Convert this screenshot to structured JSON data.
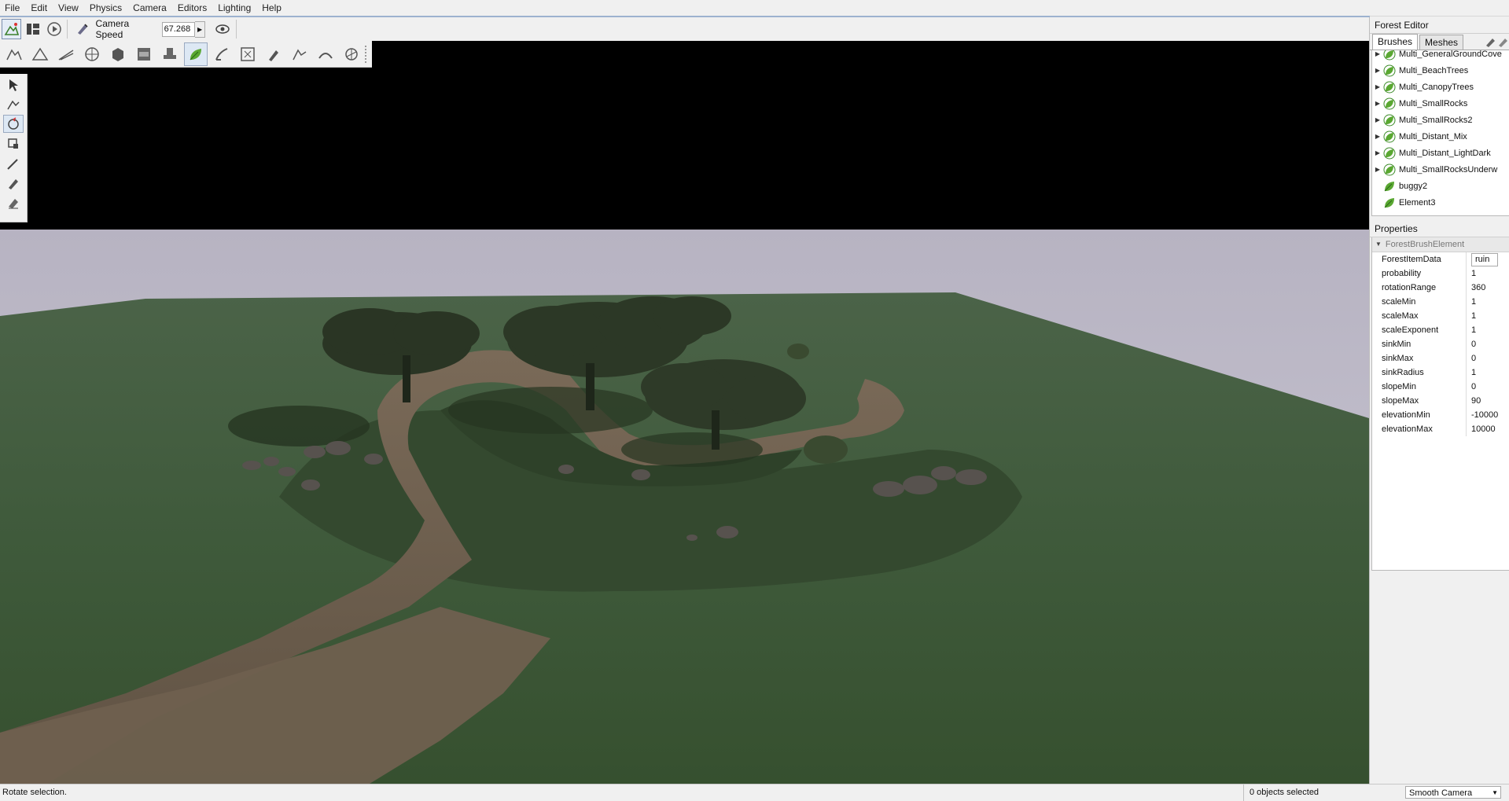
{
  "menu": {
    "items": [
      "File",
      "Edit",
      "View",
      "Physics",
      "Camera",
      "Editors",
      "Lighting",
      "Help"
    ]
  },
  "toolbar": {
    "camera_speed_label": "Camera Speed",
    "camera_speed_value": "67.268"
  },
  "forest_editor": {
    "title": "Forest Editor",
    "tabs": [
      "Brushes",
      "Meshes"
    ],
    "active_tab": "Brushes",
    "tree": [
      {
        "label": "Multi_GeneralGroundCove",
        "expandable": true
      },
      {
        "label": "Multi_BeachTrees",
        "expandable": true
      },
      {
        "label": "Multi_CanopyTrees",
        "expandable": true
      },
      {
        "label": "Multi_SmallRocks",
        "expandable": true
      },
      {
        "label": "Multi_SmallRocks2",
        "expandable": true
      },
      {
        "label": "Multi_Distant_Mix",
        "expandable": true
      },
      {
        "label": "Multi_Distant_LightDark",
        "expandable": true
      },
      {
        "label": "Multi_SmallRocksUnderw",
        "expandable": true
      },
      {
        "label": "buggy2",
        "expandable": false
      },
      {
        "label": "Element3",
        "expandable": false
      }
    ]
  },
  "properties": {
    "title": "Properties",
    "section": "ForestBrushElement",
    "rows": [
      {
        "key": "ForestItemData",
        "value": "ruin"
      },
      {
        "key": "probability",
        "value": "1"
      },
      {
        "key": "rotationRange",
        "value": "360"
      },
      {
        "key": "scaleMin",
        "value": "1"
      },
      {
        "key": "scaleMax",
        "value": "1"
      },
      {
        "key": "scaleExponent",
        "value": "1"
      },
      {
        "key": "sinkMin",
        "value": "0"
      },
      {
        "key": "sinkMax",
        "value": "0"
      },
      {
        "key": "sinkRadius",
        "value": "1"
      },
      {
        "key": "slopeMin",
        "value": "0"
      },
      {
        "key": "slopeMax",
        "value": "90"
      },
      {
        "key": "elevationMin",
        "value": "-10000"
      },
      {
        "key": "elevationMax",
        "value": "10000"
      }
    ]
  },
  "status": {
    "message": "Rotate selection.",
    "selection": "0 objects selected",
    "camera_mode": "Smooth Camera"
  },
  "colors": {
    "sky": "#c2bfcc",
    "grass": "#3f5a3b",
    "dirt": "#6e6050",
    "tree": "#2a3524",
    "accent_leaf": "#5aa832"
  }
}
